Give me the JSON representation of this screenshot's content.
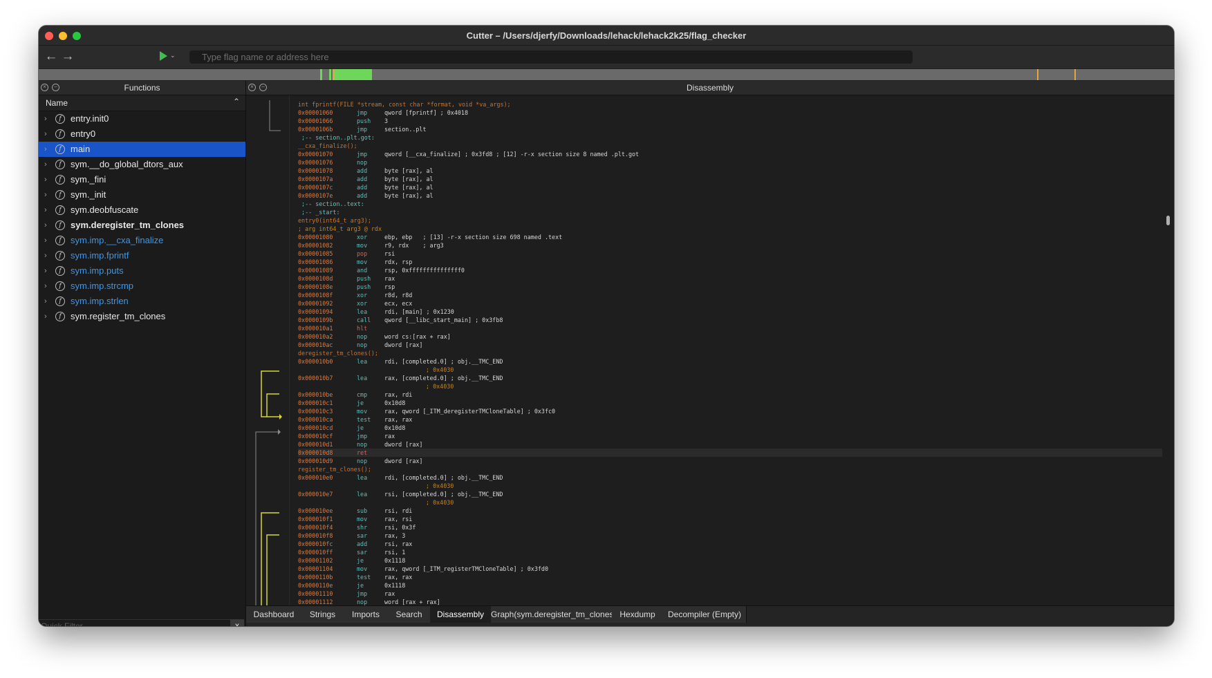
{
  "window": {
    "title": "Cutter – /Users/djerfy/Downloads/lehack/lehack2k25/flag_checker"
  },
  "toolbar": {
    "search_placeholder": "Type flag name or address here"
  },
  "functions_panel": {
    "title": "Functions",
    "column_name": "Name",
    "items": [
      {
        "label": "entry.init0"
      },
      {
        "label": "entry0"
      },
      {
        "label": "main"
      },
      {
        "label": "sym.__do_global_dtors_aux"
      },
      {
        "label": "sym._fini"
      },
      {
        "label": "sym._init"
      },
      {
        "label": "sym.deobfuscate"
      },
      {
        "label": "sym.deregister_tm_clones"
      },
      {
        "label": "sym.imp.__cxa_finalize"
      },
      {
        "label": "sym.imp.fprintf"
      },
      {
        "label": "sym.imp.puts"
      },
      {
        "label": "sym.imp.strcmp"
      },
      {
        "label": "sym.imp.strlen"
      },
      {
        "label": "sym.register_tm_clones"
      }
    ],
    "quick_filter": "Quick Filter",
    "clear": "x"
  },
  "disassembly": {
    "title": "Disassembly",
    "lines": [
      {
        "t": "lab",
        "text": "int fprintf(FILE *stream, const char *format, void *va_args);"
      },
      {
        "a": "0x00001060",
        "m": "jmp",
        "o": "qword [fprintf] ; 0x4018"
      },
      {
        "a": "0x00001066",
        "m": "push",
        "o": "3"
      },
      {
        "a": "0x0000106b",
        "m": "jmp",
        "o": "section..plt"
      },
      {
        "t": "sec",
        "text": " ;-- section..plt.got:"
      },
      {
        "t": "lab",
        "text": "__cxa_finalize();"
      },
      {
        "a": "0x00001070",
        "m": "jmp",
        "o": "qword [__cxa_finalize] ; 0x3fd8 ; [12] -r-x section size 8 named .plt.got"
      },
      {
        "a": "0x00001076",
        "m": "nop",
        "o": ""
      },
      {
        "a": "0x00001078",
        "m": "add",
        "o": "byte [rax], al"
      },
      {
        "a": "0x0000107a",
        "m": "add",
        "o": "byte [rax], al"
      },
      {
        "a": "0x0000107c",
        "m": "add",
        "o": "byte [rax], al"
      },
      {
        "a": "0x0000107e",
        "m": "add",
        "o": "byte [rax], al"
      },
      {
        "t": "sec",
        "text": " ;-- section..text:"
      },
      {
        "t": "sec",
        "text": " ;-- _start:"
      },
      {
        "t": "lab",
        "text": "entry0(int64_t arg3);"
      },
      {
        "t": "cm",
        "text": "; arg int64_t arg3 @ rdx"
      },
      {
        "a": "0x00001080",
        "m": "xor",
        "o": "ebp, ebp   ; [13] -r-x section size 698 named .text"
      },
      {
        "a": "0x00001082",
        "m": "mov",
        "o": "r9, rdx    ; arg3"
      },
      {
        "a": "0x00001085",
        "m": "pop",
        "o": "rsi",
        "red": true
      },
      {
        "a": "0x00001086",
        "m": "mov",
        "o": "rdx, rsp"
      },
      {
        "a": "0x00001089",
        "m": "and",
        "o": "rsp, 0xfffffffffffffff0"
      },
      {
        "a": "0x0000108d",
        "m": "push",
        "o": "rax"
      },
      {
        "a": "0x0000108e",
        "m": "push",
        "o": "rsp"
      },
      {
        "a": "0x0000108f",
        "m": "xor",
        "o": "r8d, r8d"
      },
      {
        "a": "0x00001092",
        "m": "xor",
        "o": "ecx, ecx"
      },
      {
        "a": "0x00001094",
        "m": "lea",
        "o": "rdi, [main] ; 0x1230"
      },
      {
        "a": "0x0000109b",
        "m": "call",
        "o": "qword [__libc_start_main] ; 0x3fb8"
      },
      {
        "a": "0x000010a1",
        "m": "hlt",
        "o": "",
        "red": true
      },
      {
        "a": "0x000010a2",
        "m": "nop",
        "o": "word cs:[rax + rax]"
      },
      {
        "a": "0x000010ac",
        "m": "nop",
        "o": "dword [rax]"
      },
      {
        "t": "lab",
        "text": "deregister_tm_clones();"
      },
      {
        "a": "0x000010b0",
        "m": "lea",
        "o": "rdi, [completed.0] ; obj.__TMC_END"
      },
      {
        "t": "cont",
        "text": "; 0x4030"
      },
      {
        "a": "0x000010b7",
        "m": "lea",
        "o": "rax, [completed.0] ; obj.__TMC_END"
      },
      {
        "t": "cont",
        "text": "; 0x4030"
      },
      {
        "a": "0x000010be",
        "m": "cmp",
        "o": "rax, rdi"
      },
      {
        "a": "0x000010c1",
        "m": "je",
        "o": "0x10d8"
      },
      {
        "a": "0x000010c3",
        "m": "mov",
        "o": "rax, qword [_ITM_deregisterTMCloneTable] ; 0x3fc0"
      },
      {
        "a": "0x000010ca",
        "m": "test",
        "o": "rax, rax"
      },
      {
        "a": "0x000010cd",
        "m": "je",
        "o": "0x10d8"
      },
      {
        "a": "0x000010cf",
        "m": "jmp",
        "o": "rax"
      },
      {
        "a": "0x000010d1",
        "m": "nop",
        "o": "dword [rax]"
      },
      {
        "a": "0x000010d8",
        "m": "ret",
        "o": "",
        "red": true,
        "hl": true
      },
      {
        "a": "0x000010d9",
        "m": "nop",
        "o": "dword [rax]"
      },
      {
        "t": "lab",
        "text": "register_tm_clones();"
      },
      {
        "a": "0x000010e0",
        "m": "lea",
        "o": "rdi, [completed.0] ; obj.__TMC_END"
      },
      {
        "t": "cont",
        "text": "; 0x4030"
      },
      {
        "a": "0x000010e7",
        "m": "lea",
        "o": "rsi, [completed.0] ; obj.__TMC_END"
      },
      {
        "t": "cont",
        "text": "; 0x4030"
      },
      {
        "a": "0x000010ee",
        "m": "sub",
        "o": "rsi, rdi"
      },
      {
        "a": "0x000010f1",
        "m": "mov",
        "o": "rax, rsi"
      },
      {
        "a": "0x000010f4",
        "m": "shr",
        "o": "rsi, 0x3f"
      },
      {
        "a": "0x000010f8",
        "m": "sar",
        "o": "rax, 3"
      },
      {
        "a": "0x000010fc",
        "m": "add",
        "o": "rsi, rax"
      },
      {
        "a": "0x000010ff",
        "m": "sar",
        "o": "rsi, 1"
      },
      {
        "a": "0x00001102",
        "m": "je",
        "o": "0x1118"
      },
      {
        "a": "0x00001104",
        "m": "mov",
        "o": "rax, qword [_ITM_registerTMCloneTable] ; 0x3fd0"
      },
      {
        "a": "0x0000110b",
        "m": "test",
        "o": "rax, rax"
      },
      {
        "a": "0x0000110e",
        "m": "je",
        "o": "0x1118"
      },
      {
        "a": "0x00001110",
        "m": "jmp",
        "o": "rax"
      },
      {
        "a": "0x00001112",
        "m": "nop",
        "o": "word [rax + rax]"
      }
    ]
  },
  "tabs": [
    {
      "label": "Dashboard"
    },
    {
      "label": "Strings"
    },
    {
      "label": "Imports"
    },
    {
      "label": "Search"
    },
    {
      "label": "Disassembly",
      "active": true
    },
    {
      "label": "Graph(sym.deregister_tm_clones)"
    },
    {
      "label": "Hexdump"
    },
    {
      "label": "Decompiler (Empty)"
    }
  ],
  "colors": {
    "selection": "#1a54c9",
    "import_fn": "#3d97ea",
    "address": "#e17b3c",
    "mnemonic": "#4cc6c4",
    "flow_arrow": "#d7d735",
    "map_green": "#6ed65a"
  }
}
